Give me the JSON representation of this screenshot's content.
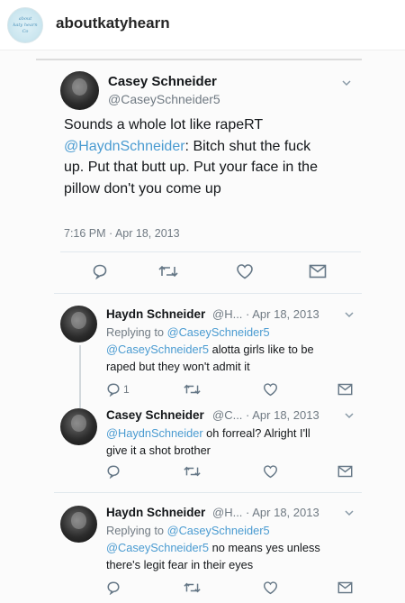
{
  "instagram": {
    "username": "aboutkatyhearn",
    "avatar_text": [
      "about",
      "katy hearn",
      "Co"
    ]
  },
  "main_tweet": {
    "name": "Casey Schneider",
    "handle": "@CaseySchneider5",
    "text_prefix": "Sounds a whole lot like rapeRT",
    "mention": "@HaydnSchneider",
    "text_rest_1": ": Bitch shut the fuck",
    "line3": "up. Put that butt up. Put your face in the",
    "line4": "pillow don't you come up",
    "time": "7:16 PM · Apr 18, 2013",
    "actions": [
      "reply-icon",
      "retweet-icon",
      "like-icon",
      "message-icon"
    ]
  },
  "replies": [
    {
      "name": "Haydn Schneider",
      "meta": "@H... · Apr 18, 2013",
      "replying_prefix": "Replying to ",
      "replying_to": "@CaseySchneider5",
      "mention": "@CaseySchneider5",
      "text_1": " alotta girls like to be",
      "text_2": "raped but they won't admit it",
      "reply_count": "1"
    },
    {
      "name": "Casey Schneider",
      "meta": "@C... · Apr 18, 2013",
      "mention": "@HaydnSchneider",
      "text_1": " oh forreal? Alright I'll",
      "text_2": "give it a shot brother"
    },
    {
      "name": "Haydn Schneider",
      "meta": "@H... · Apr 18, 2013",
      "replying_prefix": "Replying to ",
      "replying_to": "@CaseySchneider5",
      "mention": "@CaseySchneider5",
      "text_1": " no means yes unless",
      "text_2": "there's legit fear in their eyes"
    }
  ],
  "colors": {
    "link": "#4a9bd1",
    "muted": "#707a83",
    "text": "#14171a"
  }
}
